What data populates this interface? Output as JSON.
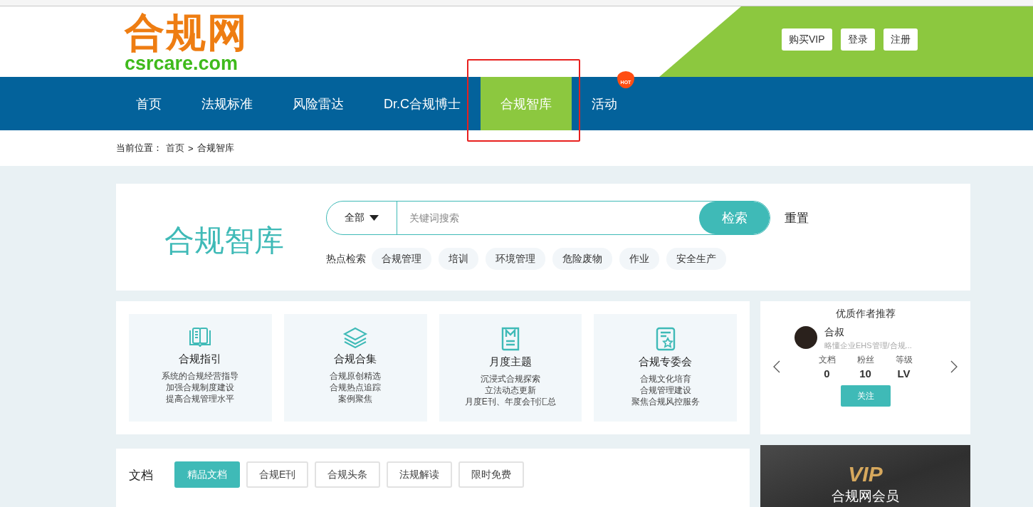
{
  "header": {
    "logo_name": "合规网",
    "logo_domain": "csrcare.com",
    "buttons": [
      "购买VIP",
      "登录",
      "注册"
    ]
  },
  "nav": [
    {
      "label": "首页",
      "selected": false,
      "highlighted": false
    },
    {
      "label": "法规标准",
      "selected": false,
      "highlighted": false
    },
    {
      "label": "风险雷达",
      "selected": false,
      "highlighted": false
    },
    {
      "label": "Dr.C合规博士",
      "selected": false,
      "highlighted": false
    },
    {
      "label": "合规智库",
      "selected": true,
      "highlighted": true
    },
    {
      "label": "活动",
      "selected": false,
      "highlighted": false,
      "badge": "HOT"
    }
  ],
  "breadcrumb": {
    "label": "当前位置：",
    "items": [
      "首页",
      "合规智库"
    ],
    "separator": ">"
  },
  "library": {
    "title": "合规智库",
    "scope": "全部",
    "placeholder": "关键词搜索",
    "search_button": "检索",
    "reset": "重置",
    "hot_label": "热点检索",
    "hot_tags": [
      "合规管理",
      "培训",
      "环境管理",
      "危险废物",
      "作业",
      "安全生产"
    ]
  },
  "features": [
    {
      "kind": "book",
      "title": "合规指引",
      "lines": [
        "系统的合规经营指导",
        "加强合规制度建设",
        "提高合规管理水平"
      ]
    },
    {
      "kind": "layers",
      "title": "合规合集",
      "lines": [
        "合规原创精选",
        "合规热点追踪",
        "案例聚焦"
      ]
    },
    {
      "kind": "magazine",
      "title": "月度主题",
      "lines": [
        "沉浸式合规探索",
        "立法动态更新",
        "月度E刊、年度会刊汇总"
      ]
    },
    {
      "kind": "certificate",
      "title": "合规专委会",
      "lines": [
        "合规文化培育",
        "合规管理建设",
        "聚焦合规风控服务"
      ]
    }
  ],
  "author_panel": {
    "title": "优质作者推荐",
    "name": "合叔",
    "bio": "略懂企业EHS管理/合规...",
    "stats": [
      {
        "label": "文档",
        "value": "0"
      },
      {
        "label": "粉丝",
        "value": "10"
      },
      {
        "label": "等级",
        "value": "LV"
      }
    ],
    "follow": "关注"
  },
  "vip_banner": {
    "logo": "VIP",
    "title": "合规网会员"
  },
  "documents": {
    "title": "文档",
    "tabs": [
      {
        "label": "精品文档",
        "selected": true
      },
      {
        "label": "合规E刊",
        "selected": false
      },
      {
        "label": "合规头条",
        "selected": false
      },
      {
        "label": "法规解读",
        "selected": false
      },
      {
        "label": "限时免费",
        "selected": false
      }
    ]
  }
}
